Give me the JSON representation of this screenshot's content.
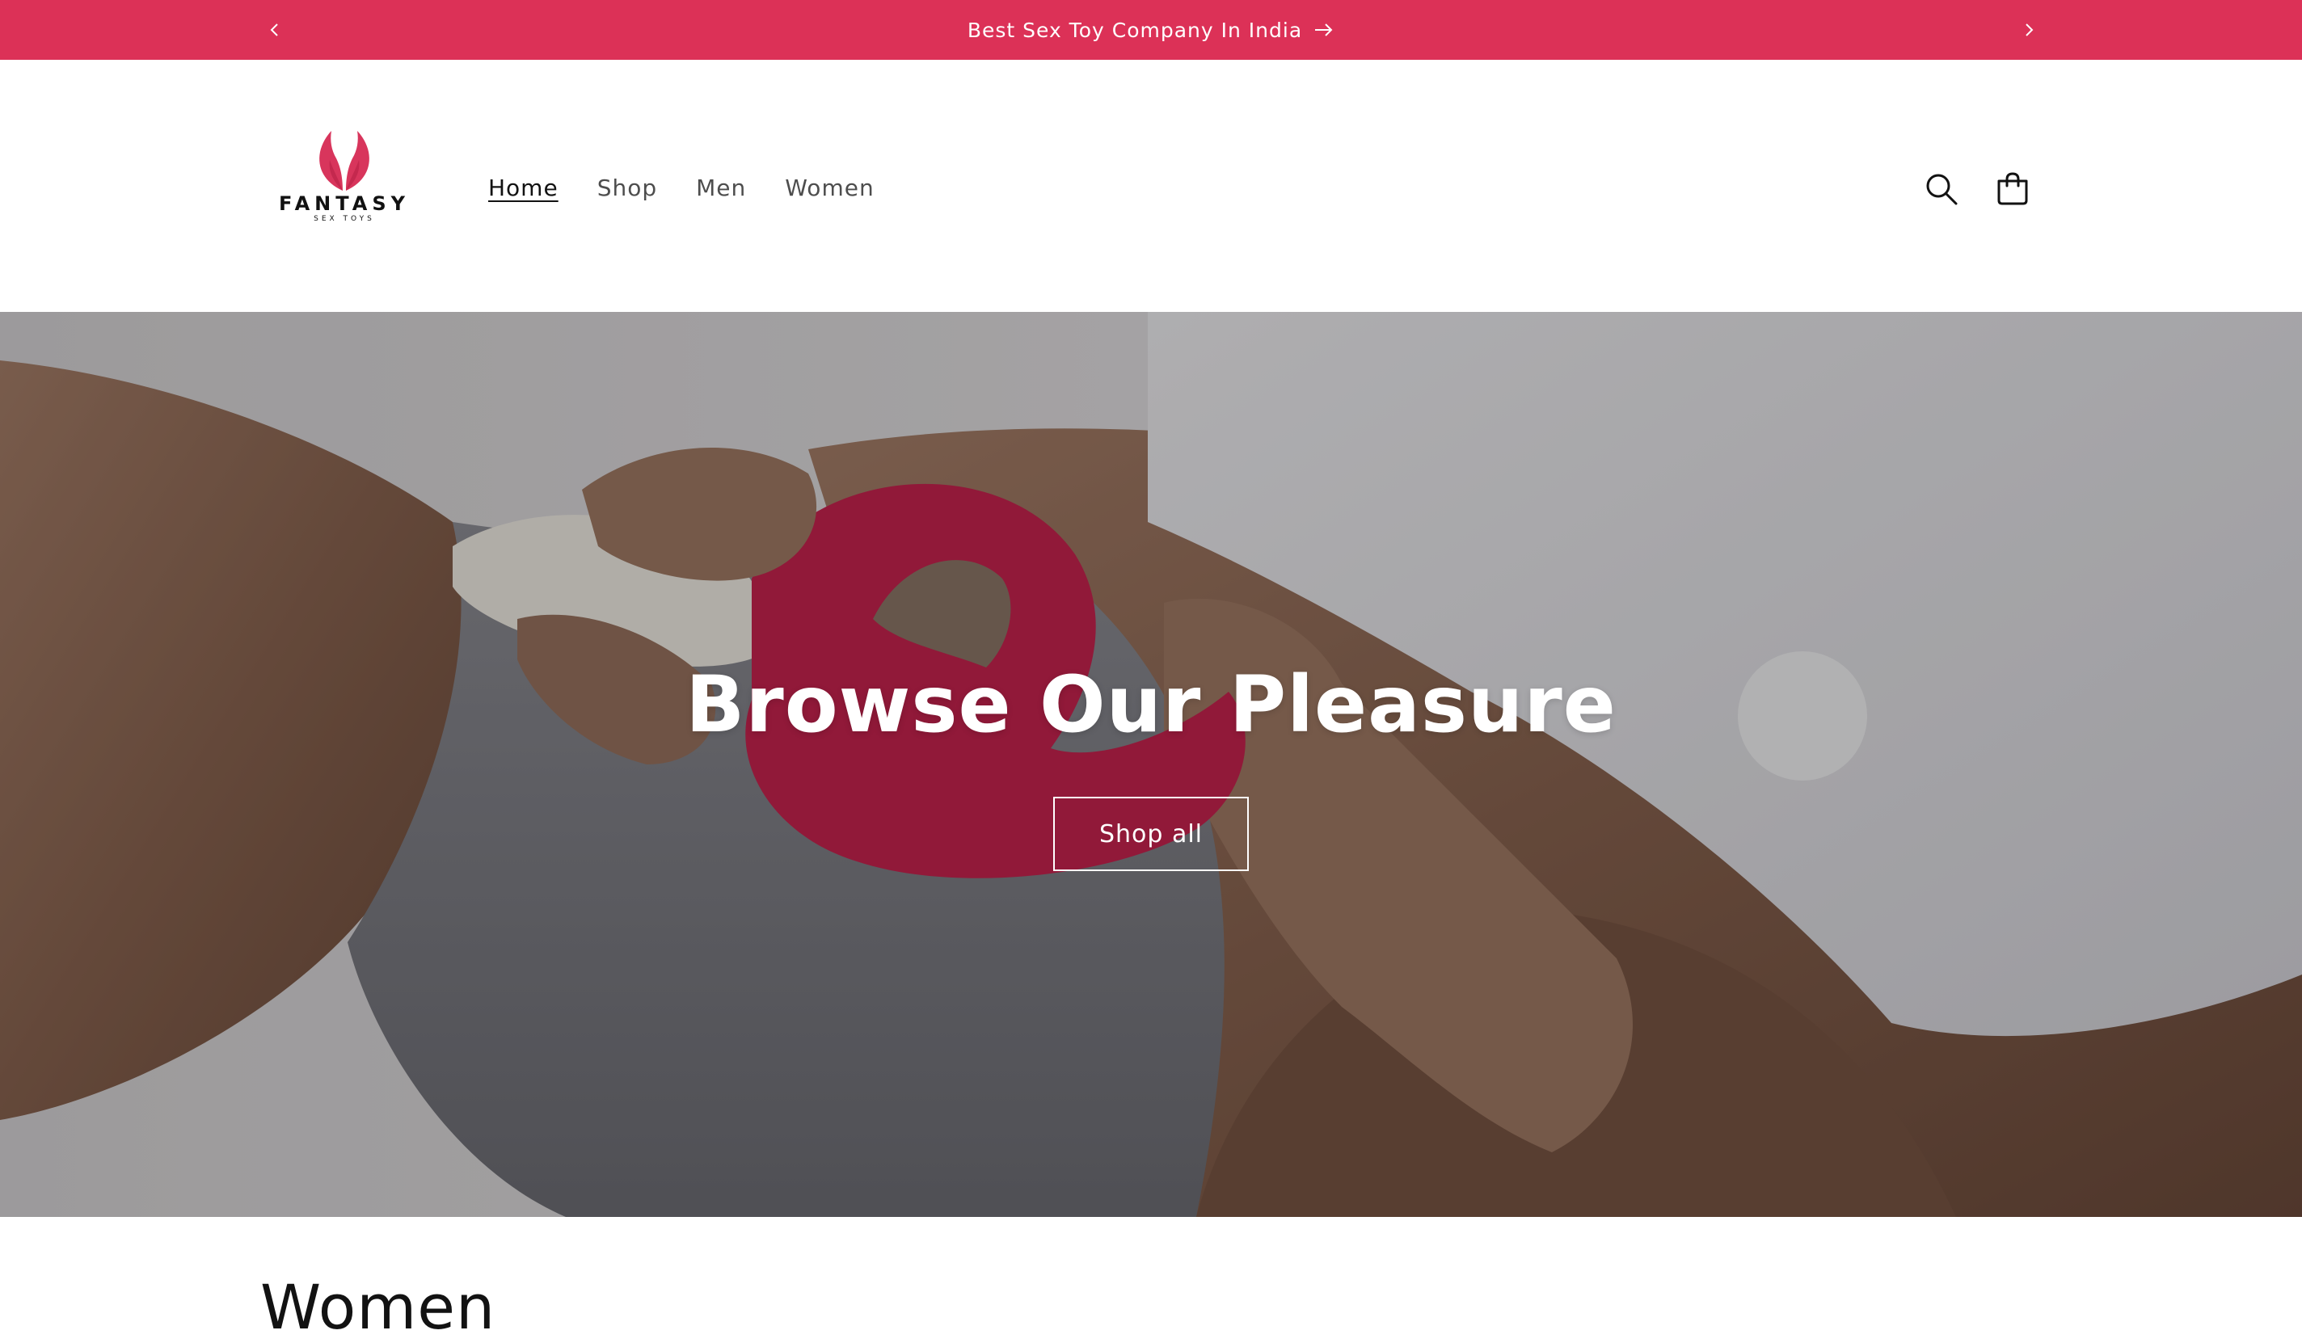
{
  "announcement": {
    "text": "Best Sex Toy Company In India",
    "prev_icon": "chevron-left-icon",
    "next_icon": "chevron-right-icon",
    "arrow_icon": "arrow-right-icon",
    "background": "#dc3157"
  },
  "header": {
    "logo": {
      "brand": "FANTASY",
      "tagline": "SEX TOYS",
      "trademark": "™",
      "accent": "#d8355c"
    },
    "nav": [
      {
        "label": "Home",
        "active": true
      },
      {
        "label": "Shop",
        "active": false
      },
      {
        "label": "Men",
        "active": false
      },
      {
        "label": "Women",
        "active": false
      }
    ],
    "icons": {
      "search": "search-icon",
      "cart": "cart-icon"
    }
  },
  "hero": {
    "title": "Browse Our Pleasure",
    "button_label": "Shop all"
  },
  "section": {
    "heading": "Women"
  }
}
